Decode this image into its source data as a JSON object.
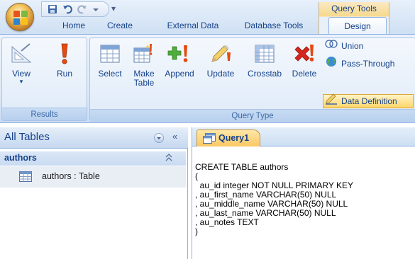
{
  "app": {
    "contextual_tab_group": "Query Tools",
    "tabs": [
      {
        "label": "Home"
      },
      {
        "label": "Create"
      },
      {
        "label": "External Data"
      },
      {
        "label": "Database Tools"
      },
      {
        "label": "Design"
      }
    ],
    "active_tab": "Design"
  },
  "ribbon": {
    "results": {
      "group_label": "Results",
      "view_label": "View",
      "run_label": "Run"
    },
    "query_type": {
      "group_label": "Query Type",
      "select_label": "Select",
      "make_table_label_1": "Make",
      "make_table_label_2": "Table",
      "append_label": "Append",
      "update_label": "Update",
      "crosstab_label": "Crosstab",
      "delete_label": "Delete",
      "union_label": "Union",
      "pass_through_label": "Pass-Through",
      "data_definition_label": "Data Definition"
    }
  },
  "nav_pane": {
    "title": "All Tables",
    "group_label": "authors",
    "items": [
      {
        "label": "authors : Table"
      }
    ]
  },
  "document": {
    "tab_label": "Query1",
    "sql_lines": [
      "CREATE TABLE authors",
      "(",
      "  au_id integer NOT NULL PRIMARY KEY",
      ", au_first_name VARCHAR(50) NULL",
      ", au_middle_name VARCHAR(50) NULL",
      ", au_last_name VARCHAR(50) NULL",
      ", au_notes TEXT",
      ")"
    ]
  },
  "colors": {
    "ribbon_text": "#15428b",
    "active_highlight": "#ffd66a",
    "doc_tab": "#fbc764"
  }
}
